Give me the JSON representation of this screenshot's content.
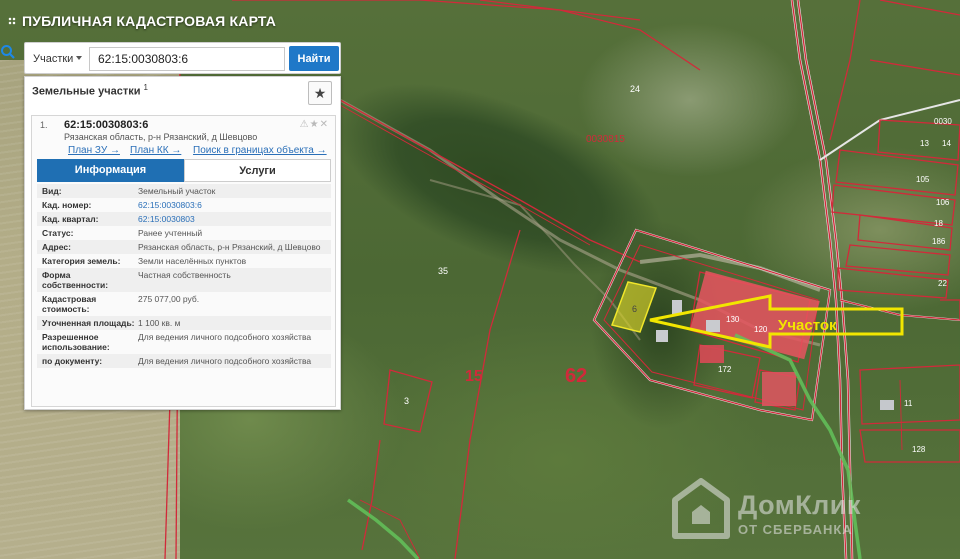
{
  "app": {
    "title": "ПУБЛИЧНАЯ КАДАСТРОВАЯ КАРТА"
  },
  "search": {
    "type_label": "Участки",
    "value": "62:15:0030803:6",
    "button_label": "Найти"
  },
  "panel": {
    "title": "Земельные участки",
    "count": "1",
    "result": {
      "index": "1.",
      "number": "62:15:0030803:6",
      "address": "Рязанская область, р-н Рязанский, д Шевцово",
      "links": [
        "План ЗУ →",
        "План КК →",
        "Поиск в границах объекта →"
      ]
    },
    "tabs": [
      "Информация",
      "Услуги"
    ],
    "rows": [
      {
        "key": "Вид:",
        "value": "Земельный участок",
        "link": false
      },
      {
        "key": "Кад. номер:",
        "value": "62:15:0030803:6",
        "link": true
      },
      {
        "key": "Кад. квартал:",
        "value": "62:15:0030803",
        "link": true
      },
      {
        "key": "Статус:",
        "value": "Ранее учтенный",
        "link": false
      },
      {
        "key": "Адрес:",
        "value": "Рязанская область, р-н Рязанский, д Шевцово",
        "link": false
      },
      {
        "key": "Категория земель:",
        "value": "Земли населённых пунктов",
        "link": false
      },
      {
        "key": "Форма собственности:",
        "value": "Частная собственность",
        "link": false
      },
      {
        "key": "Кадастровая стоимость:",
        "value": "275 077,00 руб.",
        "link": false
      },
      {
        "key": "Уточненная площадь:",
        "value": "1 100 кв. м",
        "link": false
      },
      {
        "key": "Разрешенное использование:",
        "value": "Для ведения личного подсобного хозяйства",
        "link": false
      },
      {
        "key": "по документу:",
        "value": "Для ведения личного подсобного хозяйства",
        "link": false
      }
    ]
  },
  "map": {
    "labels": {
      "quarter": "0030815",
      "parcel_24": "24",
      "parcel_35": "35",
      "parcel_15": "15",
      "parcel_62": "62",
      "parcel_3": "3",
      "parcel_6": "6",
      "parcel_130": "130",
      "parcel_120": "120",
      "parcel_172": "172",
      "parcel_13": "13",
      "parcel_0030": "0030",
      "parcel_14": "14",
      "parcel_105": "105",
      "parcel_106": "106",
      "parcel_18": "18",
      "parcel_186": "186",
      "parcel_22": "22",
      "parcel_11": "11",
      "parcel_128": "128"
    },
    "annotation": "Участок"
  },
  "watermark": {
    "main": "ДомКлик",
    "sub": "ОТ СБЕРБАНКА"
  },
  "colors": {
    "accent": "#1f78c8",
    "tab_active": "#1f6fb3",
    "boundary": "#d12a3a",
    "annotation": "#f2e600",
    "selected_parcel": "#d8d22a"
  }
}
